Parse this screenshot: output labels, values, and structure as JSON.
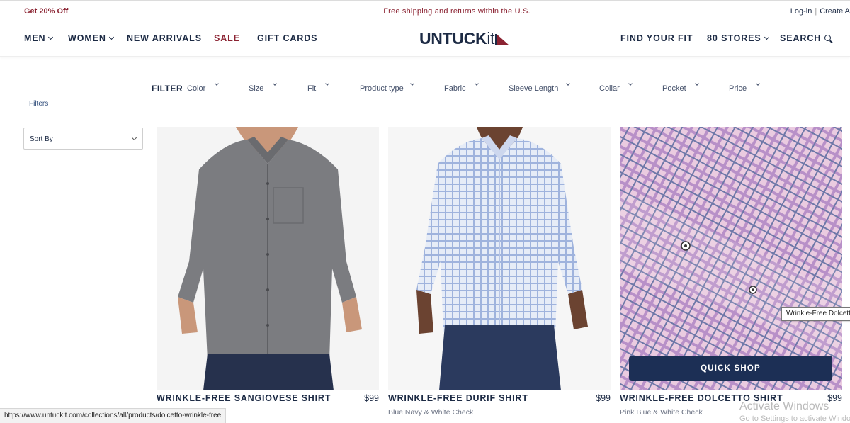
{
  "promo": {
    "left": "Get 20% Off",
    "center": "Free shipping and returns within the U.S.",
    "login": "Log-in",
    "create": "Create A"
  },
  "nav": {
    "men": "MEN",
    "women": "WOMEN",
    "new_arrivals": "NEW ARRIVALS",
    "sale": "SALE",
    "gift_cards": "GIFT CARDS",
    "logo_main": "UNTUCK",
    "logo_it": "it",
    "find_fit": "FIND YOUR FIT",
    "stores": "80 STORES",
    "search": "SEARCH"
  },
  "filter": {
    "label": "FILTER",
    "items": [
      "Color",
      "Size",
      "Fit",
      "Product type",
      "Fabric",
      "Sleeve Length",
      "Collar",
      "Pocket",
      "Price"
    ],
    "filters_link": "Filters",
    "sort_label": "Sort By"
  },
  "products": [
    {
      "name": "WRINKLE-FREE SANGIOVESE SHIRT",
      "price": "$99",
      "variant": ""
    },
    {
      "name": "WRINKLE-FREE DURIF SHIRT",
      "price": "$99",
      "variant": "Blue Navy & White Check"
    },
    {
      "name": "WRINKLE-FREE DOLCETTO SHIRT",
      "price": "$99",
      "variant": "Pink Blue & White Check"
    }
  ],
  "quick_shop": "QUICK SHOP",
  "tooltip": "Wrinkle-Free Dolcetto",
  "status_url": "https://www.untuckit.com/collections/all/products/dolcetto-wrinkle-free",
  "watermark": {
    "line1": "Activate Windows",
    "line2": "Go to Settings to activate Windows."
  },
  "colors": {
    "navy": "#1c2a44",
    "brand_red": "#8b2332",
    "button_navy": "#1c2f55"
  }
}
